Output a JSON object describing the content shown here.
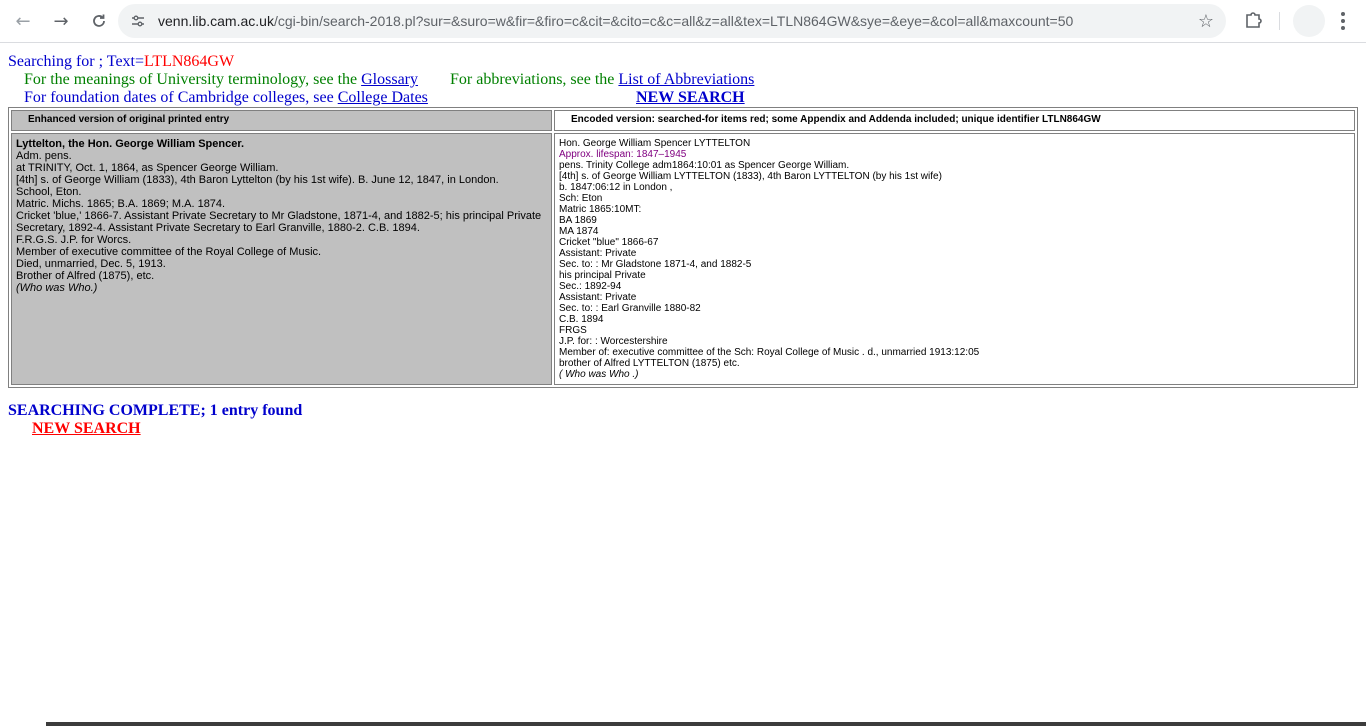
{
  "browser": {
    "url_host": "venn.lib.cam.ac.uk",
    "url_path": "/cgi-bin/search-2018.pl?sur=&suro=w&fir=&firo=c&cit=&cito=c&c=all&z=all&tex=LTLN864GW&sye=&eye=&col=all&maxcount=50"
  },
  "search": {
    "prefix": "Searching for ; Text=",
    "term": "LTLN864GW"
  },
  "info": {
    "meanings_text": "For the meanings of University terminology, see the ",
    "glossary_link": "Glossary",
    "abbrev_text": "For abbreviations, see the ",
    "abbrev_link": "List of Abbreviations",
    "foundation_text": "For foundation dates of Cambridge colleges, see ",
    "college_dates_link": "College Dates",
    "new_search": "NEW SEARCH"
  },
  "table": {
    "header_left": "Enhanced version of original printed entry",
    "header_right": "Encoded version: searched-for items red; some Appendix and Addenda included; unique identifier LTLN864GW",
    "left_name": "Lyttelton, the Hon. George William Spencer.",
    "left_lines": [
      "Adm. pens.",
      "at TRINITY, Oct. 1, 1864, as Spencer George William.",
      "[4th] s. of George William (1833), 4th Baron Lyttelton (by his 1st wife). B. June 12, 1847, in London.",
      "School, Eton.",
      "Matric. Michs. 1865; B.A. 1869; M.A. 1874.",
      "Cricket 'blue,' 1866-7. Assistant Private Secretary to Mr Gladstone, 1871-4, and 1882-5; his principal Private Secretary, 1892-4. Assistant Private Secretary to Earl Granville, 1880-2. C.B. 1894.",
      "F.R.G.S. J.P. for Worcs.",
      "Member of executive committee of the Royal College of Music.",
      "Died, unmarried, Dec. 5, 1913.",
      "Brother of Alfred (1875), etc."
    ],
    "left_wwho": "(Who was Who.)",
    "right_lines": [
      "Hon. George William Spencer LYTTELTON"
    ],
    "right_lifespan": "Approx. lifespan: 1847–1945",
    "right_lines2": [
      "pens. Trinity College adm1864:10:01 as Spencer George William.",
      "[4th] s. of George William LYTTELTON (1833), 4th Baron LYTTELTON (by his 1st wife)",
      "b. 1847:06:12 in London ,",
      "Sch: Eton",
      "Matric 1865:10MT:",
      "BA 1869",
      "MA 1874",
      "Cricket \"blue\" 1866-67",
      "Assistant: Private",
      "Sec. to: : Mr Gladstone 1871-4, and 1882-5",
      "his principal Private",
      "Sec.: 1892-94",
      "Assistant: Private",
      "Sec. to: : Earl Granville 1880-82",
      "C.B. 1894",
      "FRGS",
      "J.P. for: : Worcestershire",
      "Member of: executive committee of the Sch: Royal College of Music . d., unmarried 1913:12:05",
      "brother of Alfred LYTTELTON (1875) etc."
    ],
    "right_wwho": "( Who was Who .)"
  },
  "status": {
    "complete": "SEARCHING COMPLETE; 1 entry found",
    "new_search": "NEW SEARCH"
  }
}
